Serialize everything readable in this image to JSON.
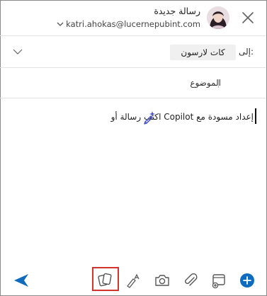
{
  "header": {
    "title": "رسالة جديدة",
    "account": "katri.ahokas@lucernepubint.com",
    "close_icon": "close-icon",
    "chevron_icon": "chevron-down-icon"
  },
  "to": {
    "label": "إلى:",
    "recipient": "كات  لارسون"
  },
  "subject": {
    "label": "الموضوع"
  },
  "body": {
    "placeholder": "اكتب رسالة أو Copilot إعداد مسودة مع"
  },
  "toolbar": {
    "icons": [
      "send-icon",
      "copilot-workspace-icon",
      "draw-icon",
      "camera-icon",
      "attach-icon",
      "compose-icon",
      "add-icon"
    ]
  },
  "colors": {
    "accent": "#0f6cbd",
    "highlight": "#d1352e"
  }
}
